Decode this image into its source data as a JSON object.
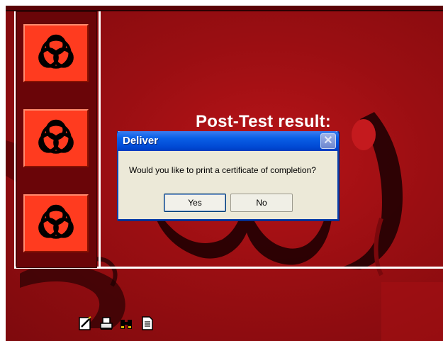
{
  "dialog": {
    "title": "Deliver",
    "message": "Would you like to print a certificate of completion?",
    "yes_label": "Yes",
    "no_label": "No",
    "close_glyph": "✕"
  },
  "content": {
    "heading": "Post-Test result:"
  },
  "sidebar": {
    "items": [
      {
        "icon": "biohazard-icon"
      },
      {
        "icon": "biohazard-icon"
      },
      {
        "icon": "biohazard-icon"
      }
    ]
  },
  "toolbar": {
    "icons": [
      "edit-note-icon",
      "print-icon",
      "binoculars-icon",
      "document-icon"
    ]
  },
  "colors": {
    "background": "#9a0e12",
    "hazard_tile": "#ff3b1f",
    "dialog_title_bar": "#0a5fe6",
    "dialog_body": "#ece9d8"
  }
}
